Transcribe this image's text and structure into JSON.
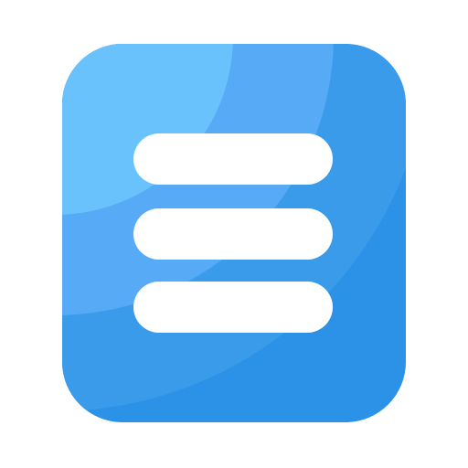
{
  "icon": {
    "name": "menu-icon",
    "colors": {
      "background": "#ffffff",
      "tile_light": "#6ac2fd",
      "tile_mid": "#56aaf6",
      "tile_dark": "#3a9bea",
      "tile_darkest": "#2b92e7",
      "bars": "#ffffff"
    }
  }
}
